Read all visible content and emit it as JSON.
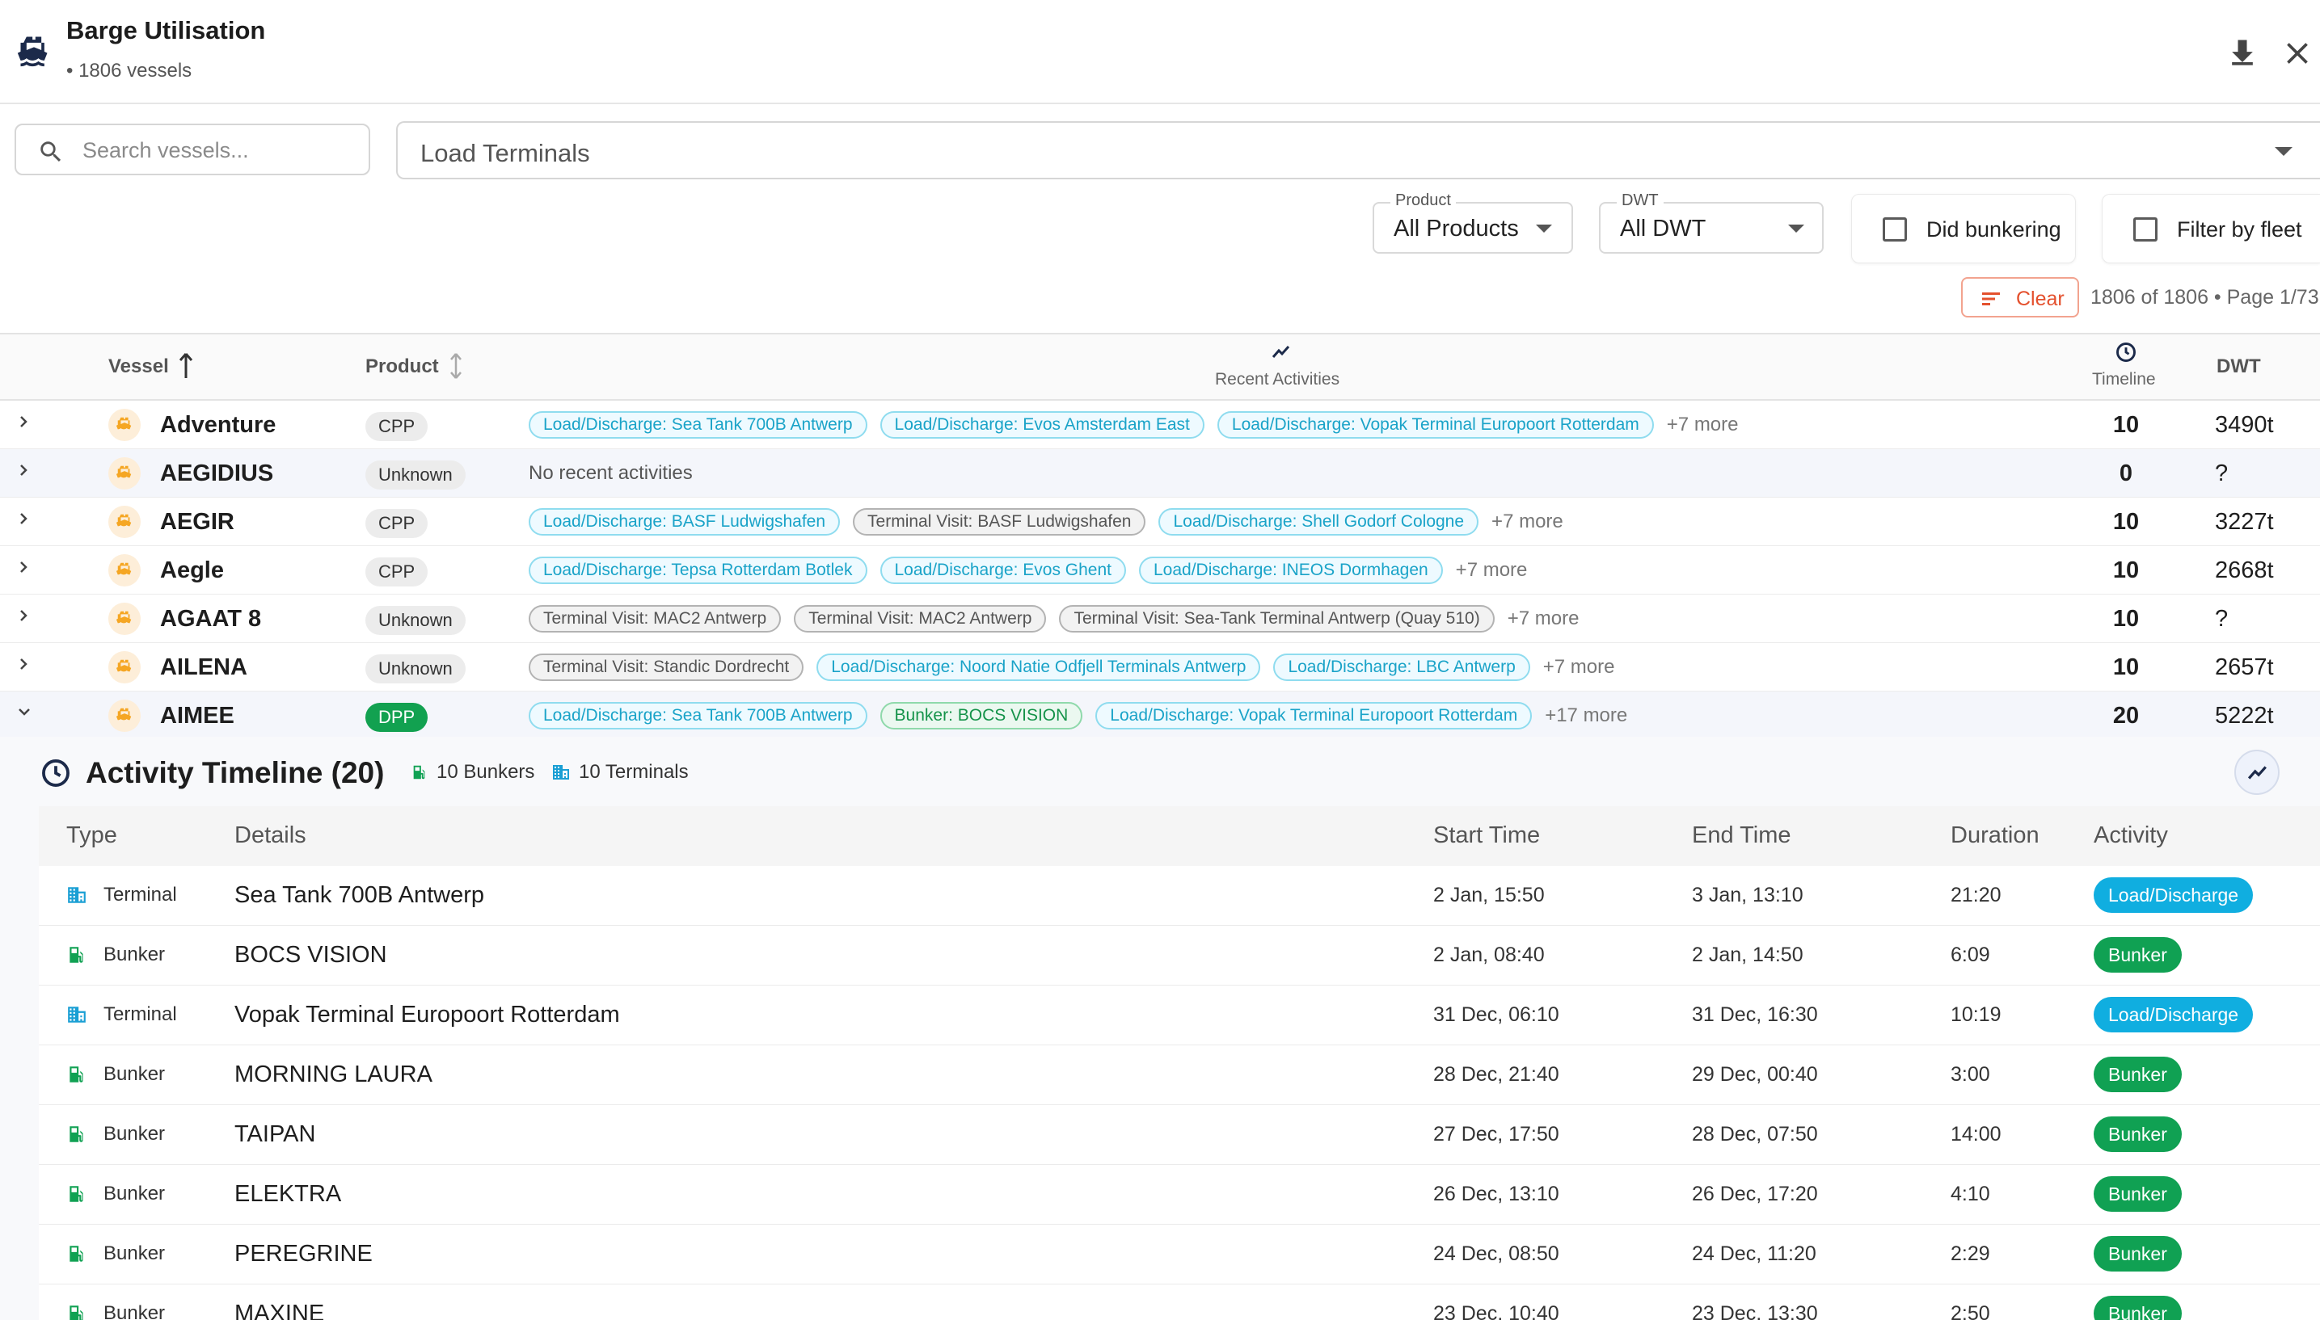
{
  "header": {
    "title": "Barge Utilisation",
    "subtitle": "• 1806 vessels"
  },
  "filters": {
    "search_placeholder": "Search vessels...",
    "terminals_placeholder": "Load Terminals",
    "product_label": "Product",
    "product_value": "All Products",
    "dwt_label": "DWT",
    "dwt_value": "All DWT",
    "did_bunkering_label": "Did bunkering",
    "filter_fleet_label": "Filter by fleet",
    "clear_label": "Clear",
    "page_info": "1806 of 1806 • Page 1/73"
  },
  "table": {
    "columns": {
      "vessel": "Vessel",
      "product": "Product",
      "recent": "Recent Activities",
      "timeline": "Timeline",
      "dwt": "DWT"
    },
    "rows": [
      {
        "name": "Adventure",
        "product": "CPP",
        "activities": [
          {
            "kind": "ld",
            "text": "Load/Discharge: Sea Tank 700B Antwerp"
          },
          {
            "kind": "ld",
            "text": "Load/Discharge: Evos Amsterdam East"
          },
          {
            "kind": "ld",
            "text": "Load/Discharge: Vopak Terminal Europoort Rotterdam"
          }
        ],
        "more": "+7 more",
        "no_activity": "",
        "timeline": "10",
        "dwt": "3490t"
      },
      {
        "name": "AEGIDIUS",
        "product": "Unknown",
        "activities": [],
        "more": "",
        "no_activity": "No recent activities",
        "timeline": "0",
        "dwt": "?"
      },
      {
        "name": "AEGIR",
        "product": "CPP",
        "activities": [
          {
            "kind": "ld",
            "text": "Load/Discharge: BASF Ludwigshafen"
          },
          {
            "kind": "tv",
            "text": "Terminal Visit: BASF Ludwigshafen"
          },
          {
            "kind": "ld",
            "text": "Load/Discharge: Shell Godorf Cologne"
          }
        ],
        "more": "+7 more",
        "no_activity": "",
        "timeline": "10",
        "dwt": "3227t"
      },
      {
        "name": "Aegle",
        "product": "CPP",
        "activities": [
          {
            "kind": "ld",
            "text": "Load/Discharge: Tepsa Rotterdam Botlek"
          },
          {
            "kind": "ld",
            "text": "Load/Discharge: Evos Ghent"
          },
          {
            "kind": "ld",
            "text": "Load/Discharge: INEOS Dormhagen"
          }
        ],
        "more": "+7 more",
        "no_activity": "",
        "timeline": "10",
        "dwt": "2668t"
      },
      {
        "name": "AGAAT 8",
        "product": "Unknown",
        "activities": [
          {
            "kind": "tv",
            "text": "Terminal Visit: MAC2 Antwerp"
          },
          {
            "kind": "tv",
            "text": "Terminal Visit: MAC2 Antwerp"
          },
          {
            "kind": "tv",
            "text": "Terminal Visit: Sea-Tank Terminal Antwerp (Quay 510)"
          }
        ],
        "more": "+7 more",
        "no_activity": "",
        "timeline": "10",
        "dwt": "?"
      },
      {
        "name": "AILENA",
        "product": "Unknown",
        "activities": [
          {
            "kind": "tv",
            "text": "Terminal Visit: Standic Dordrecht"
          },
          {
            "kind": "ld",
            "text": "Load/Discharge: Noord Natie Odfjell Terminals Antwerp"
          },
          {
            "kind": "ld",
            "text": "Load/Discharge: LBC Antwerp"
          }
        ],
        "more": "+7 more",
        "no_activity": "",
        "timeline": "10",
        "dwt": "2657t"
      },
      {
        "name": "AIMEE",
        "product": "DPP",
        "activities": [
          {
            "kind": "ld",
            "text": "Load/Discharge: Sea Tank 700B Antwerp"
          },
          {
            "kind": "bk",
            "text": "Bunker: BOCS VISION"
          },
          {
            "kind": "ld",
            "text": "Load/Discharge: Vopak Terminal Europoort Rotterdam"
          }
        ],
        "more": "+17 more",
        "no_activity": "",
        "timeline": "20",
        "dwt": "5222t"
      }
    ]
  },
  "timeline": {
    "title": "Activity Timeline (20)",
    "bunkers": "10 Bunkers",
    "terminals": "10 Terminals",
    "columns": {
      "type": "Type",
      "details": "Details",
      "start": "Start Time",
      "end": "End Time",
      "duration": "Duration",
      "activity": "Activity"
    },
    "rows": [
      {
        "type": "Terminal",
        "details": "Sea Tank 700B Antwerp",
        "start": "2 Jan, 15:50",
        "end": "3 Jan, 13:10",
        "duration": "21:20",
        "activity": "Load/Discharge"
      },
      {
        "type": "Bunker",
        "details": "BOCS VISION",
        "start": "2 Jan, 08:40",
        "end": "2 Jan, 14:50",
        "duration": "6:09",
        "activity": "Bunker"
      },
      {
        "type": "Terminal",
        "details": "Vopak Terminal Europoort Rotterdam",
        "start": "31 Dec, 06:10",
        "end": "31 Dec, 16:30",
        "duration": "10:19",
        "activity": "Load/Discharge"
      },
      {
        "type": "Bunker",
        "details": "MORNING LAURA",
        "start": "28 Dec, 21:40",
        "end": "29 Dec, 00:40",
        "duration": "3:00",
        "activity": "Bunker"
      },
      {
        "type": "Bunker",
        "details": "TAIPAN",
        "start": "27 Dec, 17:50",
        "end": "28 Dec, 07:50",
        "duration": "14:00",
        "activity": "Bunker"
      },
      {
        "type": "Bunker",
        "details": "ELEKTRA",
        "start": "26 Dec, 13:10",
        "end": "26 Dec, 17:20",
        "duration": "4:10",
        "activity": "Bunker"
      },
      {
        "type": "Bunker",
        "details": "PEREGRINE",
        "start": "24 Dec, 08:50",
        "end": "24 Dec, 11:20",
        "duration": "2:29",
        "activity": "Bunker"
      },
      {
        "type": "Bunker",
        "details": "MAXINE",
        "start": "23 Dec, 10:40",
        "end": "23 Dec, 13:30",
        "duration": "2:50",
        "activity": "Bunker"
      }
    ]
  },
  "colors": {
    "accent_cyan": "#10aee0",
    "accent_green": "#10a153",
    "clear_red": "#e4502d",
    "vessel_orange": "#f5a623"
  }
}
